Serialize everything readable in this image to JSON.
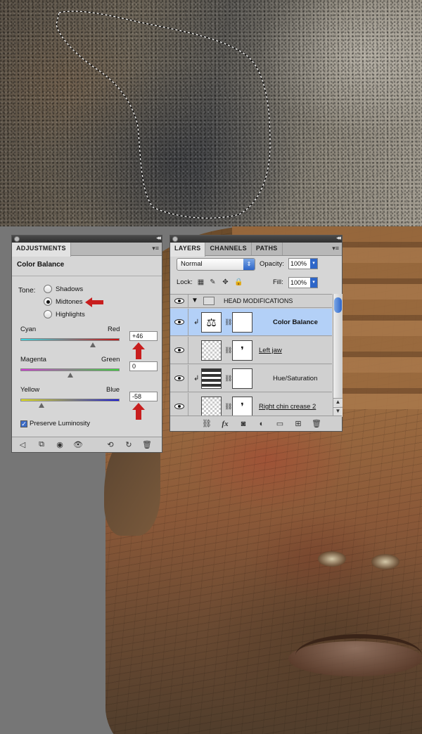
{
  "adjustments_panel": {
    "tab_label": "ADJUSTMENTS",
    "heading": "Color Balance",
    "tone_label": "Tone:",
    "tone_options": [
      {
        "label": "Shadows",
        "checked": false
      },
      {
        "label": "Midtones",
        "checked": true
      },
      {
        "label": "Highlights",
        "checked": false
      }
    ],
    "sliders": [
      {
        "left_label": "Cyan",
        "right_label": "Red",
        "value": "+46",
        "fraction": 0.73
      },
      {
        "left_label": "Magenta",
        "right_label": "Green",
        "value": "0",
        "fraction": 0.5
      },
      {
        "left_label": "Yellow",
        "right_label": "Blue",
        "value": "-58",
        "fraction": 0.21
      }
    ],
    "preserve_luminosity_label": "Preserve Luminosity",
    "preserve_luminosity_checked": true,
    "footer_icons": [
      "back-arrow-icon",
      "clip-to-layer-icon",
      "toggle-view-icon",
      "visibility-eye-icon",
      "previous-state-icon",
      "reset-icon",
      "delete-icon"
    ]
  },
  "layers_panel": {
    "tabs": [
      "LAYERS",
      "CHANNELS",
      "PATHS"
    ],
    "blend_mode": "Normal",
    "opacity_label": "Opacity:",
    "opacity_value": "100%",
    "lock_label": "Lock:",
    "fill_label": "Fill:",
    "fill_value": "100%",
    "layers": [
      {
        "name": "HEAD MODIFICATIONS",
        "kind": "group",
        "selected": false
      },
      {
        "name": "Color Balance",
        "kind": "adjustment",
        "selected": true
      },
      {
        "name": "Left jaw",
        "kind": "masked",
        "selected": false
      },
      {
        "name": "Hue/Saturation",
        "kind": "adjustment",
        "selected": false
      },
      {
        "name": "Right chin crease 2",
        "kind": "masked",
        "selected": false
      }
    ],
    "footer_icons": [
      "link-layers-icon",
      "fx-icon",
      "add-mask-icon",
      "new-adjustment-icon",
      "new-group-icon",
      "new-layer-icon",
      "trash-icon"
    ],
    "fx_text": "fx"
  },
  "colors": {
    "annotation_arrow": "#c81e1e",
    "selection_blue": "#b3d0f7",
    "accent_blue": "#2e66c8"
  }
}
